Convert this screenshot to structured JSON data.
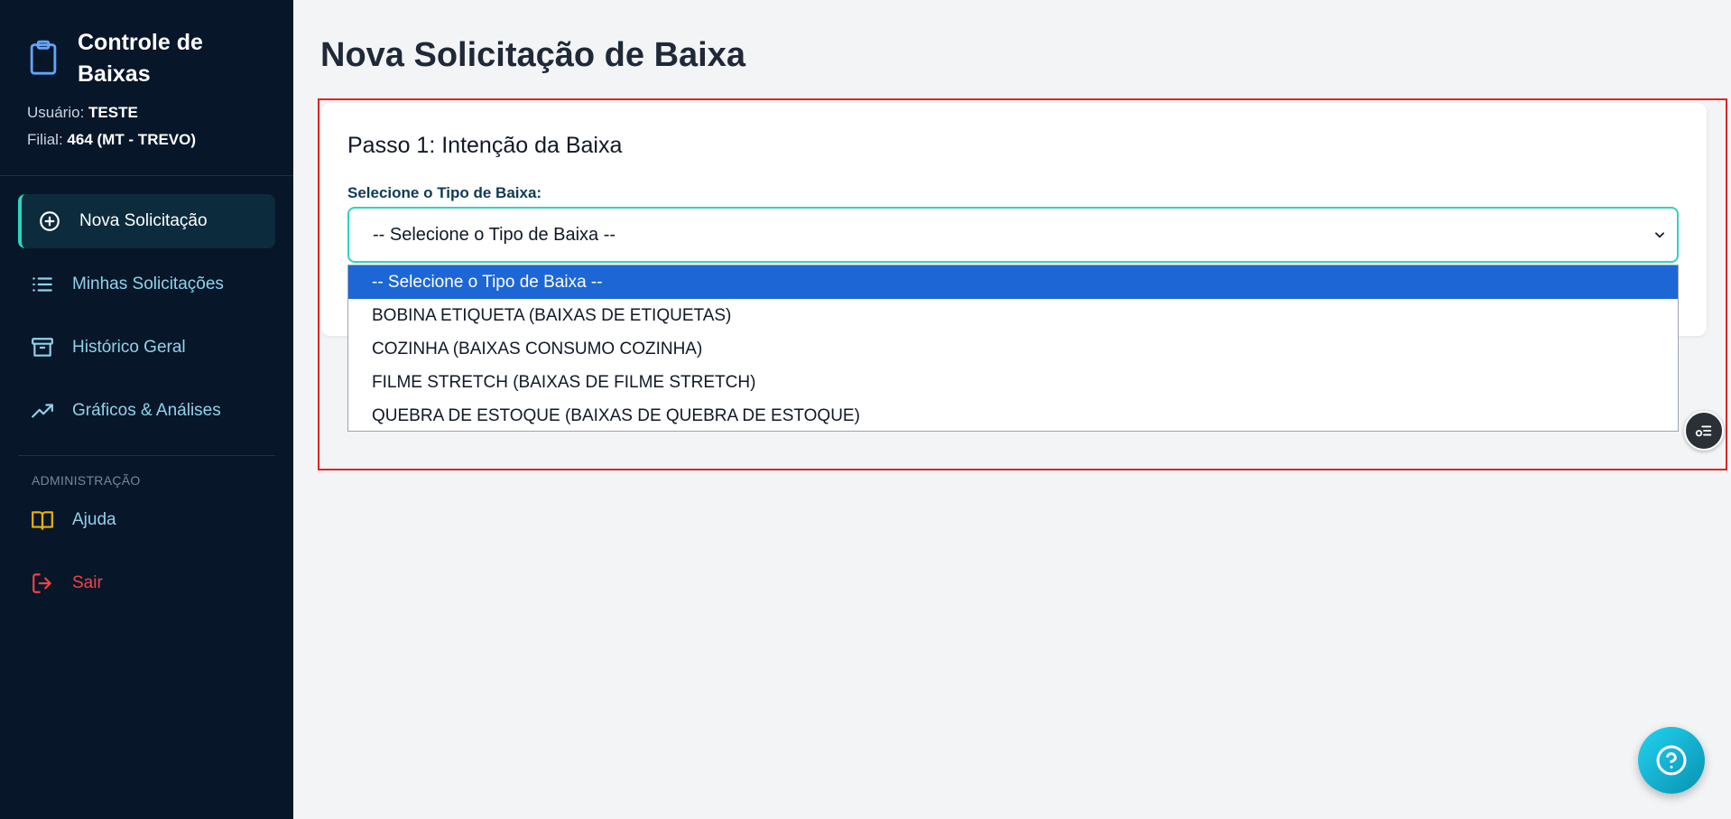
{
  "sidebar": {
    "brand_title": "Controle de Baixas",
    "user_label": "Usuário:",
    "user_value": "TESTE",
    "branch_label": "Filial:",
    "branch_value": "464 (MT - TREVO)",
    "items": [
      {
        "label": "Nova Solicitação",
        "icon": "plus-circle-icon",
        "active": true
      },
      {
        "label": "Minhas Solicitações",
        "icon": "list-icon"
      },
      {
        "label": "Histórico Geral",
        "icon": "archive-icon"
      },
      {
        "label": "Gráficos & Análises",
        "icon": "trending-up-icon"
      }
    ],
    "admin_section_label": "ADMINISTRAÇÃO",
    "admin_items": [
      {
        "label": "Ajuda",
        "icon": "book-icon",
        "color": "#eab308"
      },
      {
        "label": "Sair",
        "icon": "logout-icon",
        "color": "#ef4444"
      }
    ]
  },
  "main": {
    "page_title": "Nova Solicitação de Baixa",
    "step_title": "Passo 1: Intenção da Baixa",
    "select_label": "Selecione o Tipo de Baixa:",
    "select_value": "-- Selecione o Tipo de Baixa --",
    "options": [
      "-- Selecione o Tipo de Baixa --",
      "BOBINA ETIQUETA (BAIXAS DE ETIQUETAS)",
      "COZINHA (BAIXAS CONSUMO COZINHA)",
      "FILME STRETCH (BAIXAS DE FILME STRETCH)",
      "QUEBRA DE ESTOQUE (BAIXAS DE QUEBRA DE ESTOQUE)"
    ]
  },
  "colors": {
    "sidebar_bg": "#08162a",
    "accent": "#2dd4bf",
    "selected_option": "#1d66d6",
    "highlight_border": "#e02424"
  }
}
